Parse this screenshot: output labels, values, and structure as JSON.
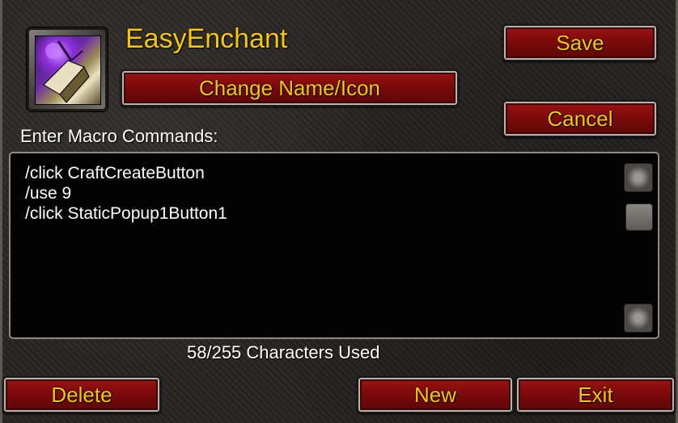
{
  "macro": {
    "name": "EasyEnchant",
    "icon": "enchant-scroll-icon"
  },
  "buttons": {
    "change_name_icon": "Change Name/Icon",
    "save": "Save",
    "cancel": "Cancel",
    "delete": "Delete",
    "new": "New",
    "exit": "Exit"
  },
  "editor": {
    "prompt": "Enter Macro Commands:",
    "text": "/click CraftCreateButton\n/use 9\n/click StaticPopup1Button1",
    "chars_used": "58/255 Characters Used"
  },
  "colors": {
    "gold_text": "#f7c800",
    "button_red": "#8a0c0c",
    "editor_bg": "#030303"
  }
}
